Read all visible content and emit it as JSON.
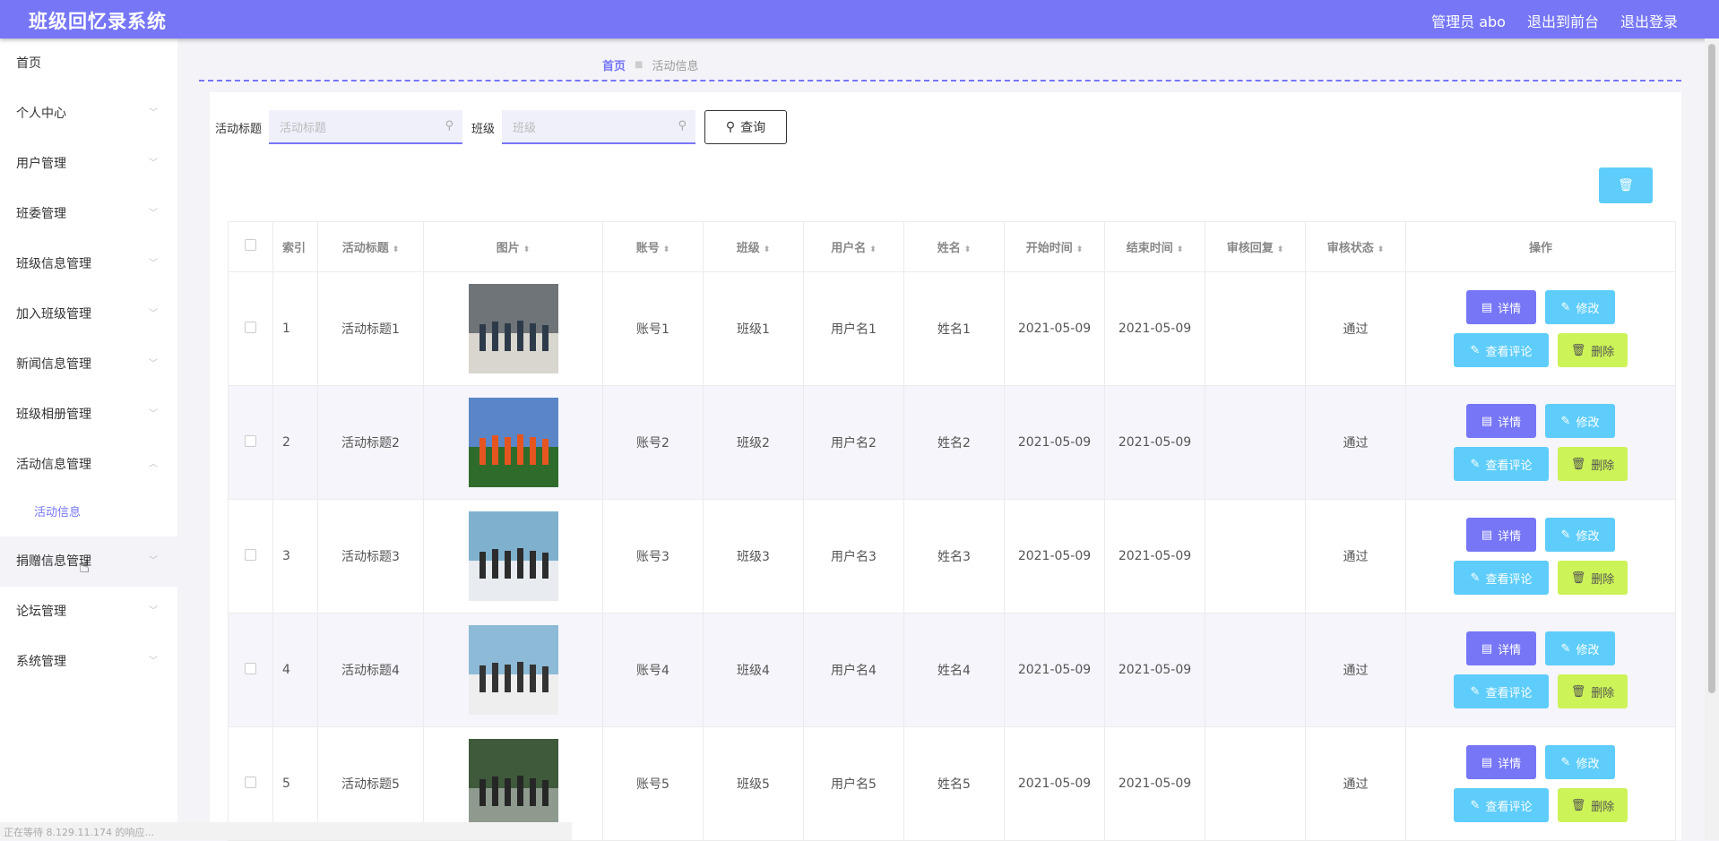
{
  "app": {
    "title": "班级回忆录系统"
  },
  "topbar": {
    "admin_label": "管理员 abo",
    "back_front": "退出到前台",
    "logout": "退出登录"
  },
  "sidebar": {
    "items": [
      {
        "label": "首页"
      },
      {
        "label": "个人中心"
      },
      {
        "label": "用户管理"
      },
      {
        "label": "班委管理"
      },
      {
        "label": "班级信息管理"
      },
      {
        "label": "加入班级管理"
      },
      {
        "label": "新闻信息管理"
      },
      {
        "label": "班级相册管理"
      },
      {
        "label": "活动信息管理"
      },
      {
        "label": "捐赠信息管理"
      },
      {
        "label": "论坛管理"
      },
      {
        "label": "系统管理"
      }
    ],
    "sub_item": "活动信息"
  },
  "breadcrumb": {
    "home": "首页",
    "current": "活动信息"
  },
  "search": {
    "title_label": "活动标题",
    "title_placeholder": "活动标题",
    "class_label": "班级",
    "class_placeholder": "班级",
    "query_label": "查询"
  },
  "table": {
    "headers": [
      "索引",
      "活动标题",
      "图片",
      "账号",
      "班级",
      "用户名",
      "姓名",
      "开始时间",
      "结束时间",
      "审核回复",
      "审核状态",
      "操作"
    ],
    "rows": [
      {
        "index": "1",
        "title": "活动标题1",
        "account": "账号1",
        "class": "班级1",
        "username": "用户名1",
        "name": "姓名1",
        "start": "2021-05-09",
        "end": "2021-05-09",
        "reply": "",
        "status": "通过"
      },
      {
        "index": "2",
        "title": "活动标题2",
        "account": "账号2",
        "class": "班级2",
        "username": "用户名2",
        "name": "姓名2",
        "start": "2021-05-09",
        "end": "2021-05-09",
        "reply": "",
        "status": "通过"
      },
      {
        "index": "3",
        "title": "活动标题3",
        "account": "账号3",
        "class": "班级3",
        "username": "用户名3",
        "name": "姓名3",
        "start": "2021-05-09",
        "end": "2021-05-09",
        "reply": "",
        "status": "通过"
      },
      {
        "index": "4",
        "title": "活动标题4",
        "account": "账号4",
        "class": "班级4",
        "username": "用户名4",
        "name": "姓名4",
        "start": "2021-05-09",
        "end": "2021-05-09",
        "reply": "",
        "status": "通过"
      },
      {
        "index": "5",
        "title": "活动标题5",
        "account": "账号5",
        "class": "班级5",
        "username": "用户名5",
        "name": "姓名5",
        "start": "2021-05-09",
        "end": "2021-05-09",
        "reply": "",
        "status": "通过"
      }
    ],
    "actions": {
      "detail": "详情",
      "edit": "修改",
      "comment": "查看评论",
      "delete": "删除"
    }
  },
  "statusbar": {
    "text": "正在等待 8.129.11.174 的响应..."
  },
  "colors": {
    "accent": "#7676f7",
    "cyan": "#5ecdfb",
    "lime": "#ccf357"
  }
}
